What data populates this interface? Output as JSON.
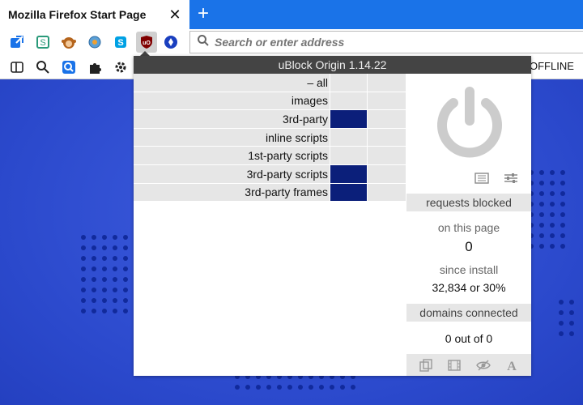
{
  "browser": {
    "tab_title": "Mozilla Firefox Start Page",
    "close_glyph": "✕",
    "newtab_glyph": "+",
    "url_placeholder": "Search or enter address",
    "offline_label": "OFFLINE"
  },
  "extensions_row1": [
    "external-link-icon",
    "s-extension-icon",
    "monkey-extension-icon",
    "globe-extension-icon",
    "skype-icon",
    "ublock-origin-icon",
    "navigation-extension-icon"
  ],
  "extensions_row2": [
    "sidebar-icon",
    "search-icon",
    "search-blue-icon",
    "puzzle-icon",
    "gear-icon"
  ],
  "ublock": {
    "title": "uBlock Origin 1.14.22",
    "firewall_rows": [
      {
        "label": "– all",
        "blocked": false
      },
      {
        "label": "images",
        "blocked": false
      },
      {
        "label": "3rd-party",
        "blocked": true
      },
      {
        "label": "inline scripts",
        "blocked": false
      },
      {
        "label": "1st-party scripts",
        "blocked": false
      },
      {
        "label": "3rd-party scripts",
        "blocked": true
      },
      {
        "label": "3rd-party frames",
        "blocked": true
      }
    ],
    "requests_blocked_label": "requests blocked",
    "on_this_page_label": "on this page",
    "on_this_page_value": "0",
    "since_install_label": "since install",
    "since_install_value": "32,834 or 30%",
    "domains_connected_label": "domains connected",
    "domains_value": "0 out of 0"
  },
  "colors": {
    "tabstrip": "#1a73e8",
    "popup_header": "#444444",
    "blocked_cell": "#0b1f7a",
    "power_icon": "#cccccc"
  }
}
